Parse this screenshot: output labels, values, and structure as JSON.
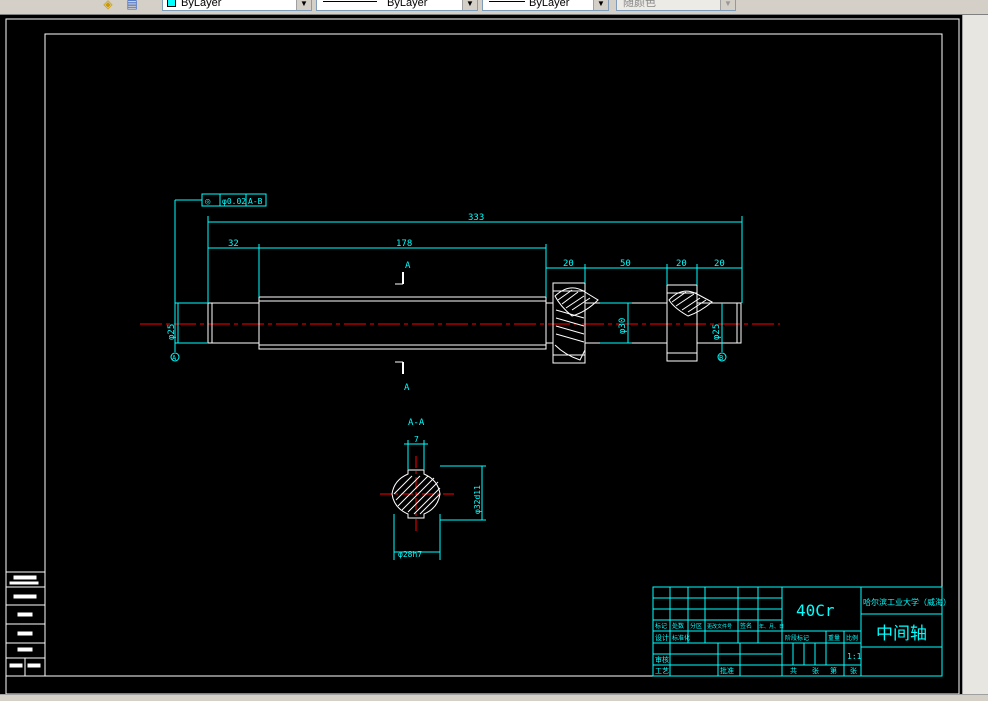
{
  "toolbar": {
    "color_control": "ByLayer",
    "linetype_control": "ByLayer",
    "lineweight_control": "ByLayer",
    "plotstyle_control": "随颜色",
    "icons": [
      "layer-states-icon",
      "layer-previous-icon"
    ]
  },
  "drawing": {
    "dimensions": {
      "overall_length": "333",
      "left_step": "32",
      "middle_length": "178",
      "gear_width": "20",
      "gap": "50",
      "bearing_a": "20",
      "bearing_b": "20",
      "dia_left": "φ25",
      "dia_gear": "φ30",
      "dia_right": "φ25",
      "keyway_width": "7",
      "spline_major": "φ32d11",
      "spline_minor": "φ28h7"
    },
    "tolerance_frame": {
      "symbol": "◎",
      "value": "φ0.02",
      "datum": "A-B"
    },
    "section_marks": {
      "cut_label_top": "A",
      "cut_label_bottom": "A",
      "section_title": "A-A"
    },
    "datum_left": "A",
    "datum_right": "B"
  },
  "title_block": {
    "material": "40Cr",
    "school": "哈尔滨工业大学（威海）",
    "part_name": "中间轴",
    "scale": "1:1",
    "revision_headers": [
      "标记",
      "处数",
      "分区",
      "更改文件号",
      "签名",
      "年、月、日"
    ],
    "sign_rows": [
      "设计",
      "标准化",
      "审核",
      "工艺",
      "批准"
    ],
    "stage_headers": [
      "阶段标记",
      "重量",
      "比例"
    ],
    "sheet_info": [
      "共",
      "张",
      "第",
      "张"
    ]
  }
}
